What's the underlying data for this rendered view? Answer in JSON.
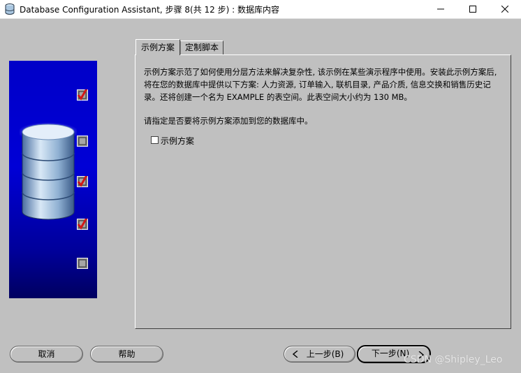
{
  "window": {
    "title": "Database Configuration Assistant, 步骤 8(共 12 步) : 数据库内容",
    "controls": [
      "minimize-icon",
      "maximize-icon",
      "close-icon"
    ]
  },
  "steps_panel": {
    "steps": [
      {
        "state": "checked"
      },
      {
        "state": "unchecked"
      },
      {
        "state": "checked"
      },
      {
        "state": "checked"
      },
      {
        "state": "unchecked"
      }
    ]
  },
  "tabs": [
    {
      "label": "示例方案",
      "active": true
    },
    {
      "label": "定制脚本",
      "active": false
    }
  ],
  "content": {
    "description": "示例方案示范了如何使用分层方法来解决复杂性, 该示例在某些演示程序中使用。安装此示例方案后, 将在您的数据库中提供以下方案: 人力资源, 订单输入, 联机目录, 产品介质, 信息交换和销售历史记录。还将创建一个名为 EXAMPLE 的表空间。此表空间大小约为 130 MB。",
    "prompt": "请指定是否要将示例方案添加到您的数据库中。",
    "checkbox": {
      "label": "示例方案",
      "checked": false
    }
  },
  "buttons": {
    "cancel": "取消",
    "help": "帮助",
    "back": "上一步(B)",
    "next": "下一步(N)"
  },
  "watermark": "CSDN @Shipley_Leo",
  "colors": {
    "panel_bg": "#c0c0c0",
    "side_panel_blue": "#0000c8",
    "check_red": "#d01818"
  }
}
